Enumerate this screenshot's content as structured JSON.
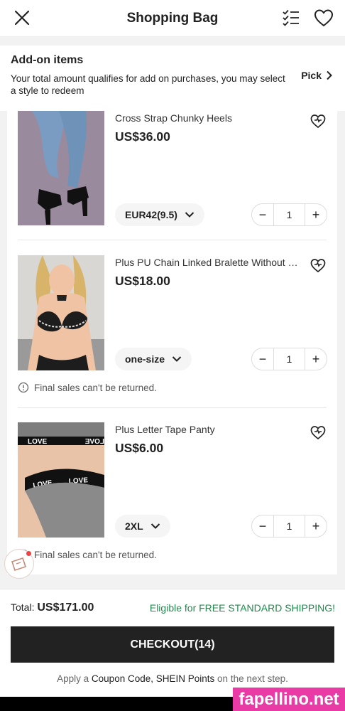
{
  "header": {
    "title": "Shopping Bag"
  },
  "addon": {
    "title": "Add-on items",
    "description": "Your total amount qualifies for add on purchases, you may select a style to redeem",
    "pick_label": "Pick"
  },
  "items": [
    {
      "name": "Cross Strap Chunky Heels",
      "price": "US$36.00",
      "size": "EUR42(9.5)",
      "quantity": "1",
      "note": ""
    },
    {
      "name": "Plus PU Chain Linked Bralette Without Lining",
      "price": "US$18.00",
      "size": "one-size",
      "quantity": "1",
      "note": "Final sales can't be returned."
    },
    {
      "name": "Plus Letter Tape Panty",
      "price": "US$6.00",
      "size": "2XL",
      "quantity": "1",
      "note": "Final sales can't be returned.",
      "tape_text": "LOVE"
    }
  ],
  "footer": {
    "total_label": "Total:",
    "total_value": "US$171.00",
    "shipping": "Eligible for FREE STANDARD SHIPPING!",
    "checkout_label": "CHECKOUT(14)",
    "apply_prefix": "Apply a",
    "apply_coupon": "Coupon Code, SHEIN Points",
    "apply_suffix": "on the next step."
  },
  "watermark": "fapellino.net",
  "colors": {
    "shipping_green": "#1f8b4c",
    "checkout_bg": "#222222",
    "watermark_pink": "#ea3aa5"
  }
}
